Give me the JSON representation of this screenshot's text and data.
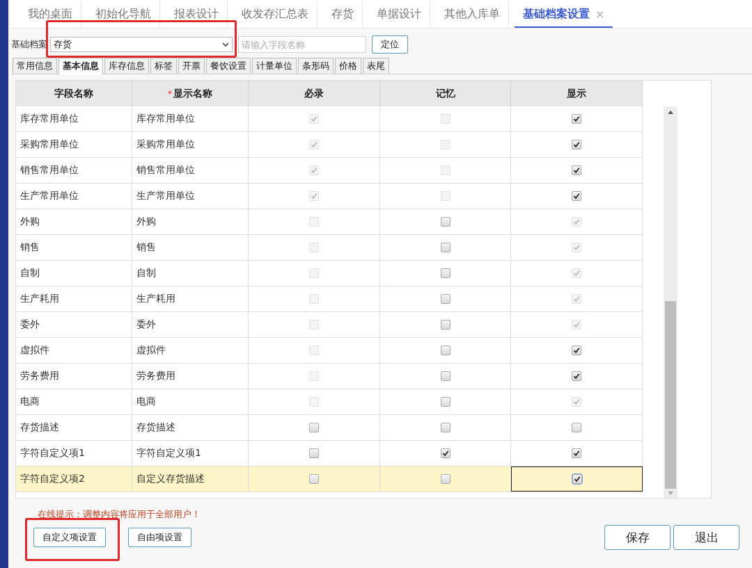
{
  "top_tabs": [
    {
      "label": "我的桌面",
      "selected": false
    },
    {
      "label": "初始化导航",
      "selected": false
    },
    {
      "label": "报表设计",
      "selected": false
    },
    {
      "label": "收发存汇总表",
      "selected": false
    },
    {
      "label": "存货",
      "selected": false
    },
    {
      "label": "单据设计",
      "selected": false
    },
    {
      "label": "其他入库单",
      "selected": false
    },
    {
      "label": "基础档案设置",
      "selected": true,
      "close": "×"
    }
  ],
  "archive": {
    "label": "基础档案",
    "value": "存货"
  },
  "search": {
    "placeholder": "请输入字段名称"
  },
  "locate_button": "定位",
  "sub_tabs": [
    {
      "label": "常用信息",
      "selected": false
    },
    {
      "label": "基本信息",
      "selected": true
    },
    {
      "label": "库存信息",
      "selected": false
    },
    {
      "label": "标签",
      "selected": false
    },
    {
      "label": "开票",
      "selected": false
    },
    {
      "label": "餐饮设置",
      "selected": false
    },
    {
      "label": "计量单位",
      "selected": false
    },
    {
      "label": "条形码",
      "selected": false
    },
    {
      "label": "价格",
      "selected": false
    },
    {
      "label": "表尾",
      "selected": false
    }
  ],
  "table": {
    "columns": [
      {
        "label": "字段名称"
      },
      {
        "label": "显示名称",
        "mark": "*"
      },
      {
        "label": "必录"
      },
      {
        "label": "记忆"
      },
      {
        "label": "显示"
      }
    ],
    "rows": [
      {
        "field": "库存常用单位",
        "display": "库存常用单位",
        "selected": false,
        "required": {
          "checked": true,
          "disabled": true
        },
        "memory": {
          "checked": false,
          "disabled": true
        },
        "show": {
          "checked": true,
          "disabled": false
        }
      },
      {
        "field": "采购常用单位",
        "display": "采购常用单位",
        "selected": false,
        "required": {
          "checked": true,
          "disabled": true
        },
        "memory": {
          "checked": false,
          "disabled": true
        },
        "show": {
          "checked": true,
          "disabled": false
        }
      },
      {
        "field": "销售常用单位",
        "display": "销售常用单位",
        "selected": false,
        "required": {
          "checked": true,
          "disabled": true
        },
        "memory": {
          "checked": false,
          "disabled": true
        },
        "show": {
          "checked": true,
          "disabled": false
        }
      },
      {
        "field": "生产常用单位",
        "display": "生产常用单位",
        "selected": false,
        "required": {
          "checked": true,
          "disabled": true
        },
        "memory": {
          "checked": false,
          "disabled": true
        },
        "show": {
          "checked": true,
          "disabled": false
        }
      },
      {
        "field": "外购",
        "display": "外购",
        "selected": false,
        "required": {
          "checked": false,
          "disabled": true
        },
        "memory": {
          "checked": false,
          "disabled": false
        },
        "show": {
          "checked": true,
          "disabled": true
        }
      },
      {
        "field": "销售",
        "display": "销售",
        "selected": false,
        "required": {
          "checked": false,
          "disabled": true
        },
        "memory": {
          "checked": false,
          "disabled": false
        },
        "show": {
          "checked": true,
          "disabled": true
        }
      },
      {
        "field": "自制",
        "display": "自制",
        "selected": false,
        "required": {
          "checked": false,
          "disabled": true
        },
        "memory": {
          "checked": false,
          "disabled": false
        },
        "show": {
          "checked": true,
          "disabled": true
        }
      },
      {
        "field": "生产耗用",
        "display": "生产耗用",
        "selected": false,
        "required": {
          "checked": false,
          "disabled": true
        },
        "memory": {
          "checked": false,
          "disabled": false
        },
        "show": {
          "checked": true,
          "disabled": true
        }
      },
      {
        "field": "委外",
        "display": "委外",
        "selected": false,
        "required": {
          "checked": false,
          "disabled": true
        },
        "memory": {
          "checked": false,
          "disabled": false
        },
        "show": {
          "checked": true,
          "disabled": true
        }
      },
      {
        "field": "虚拟件",
        "display": "虚拟件",
        "selected": false,
        "required": {
          "checked": false,
          "disabled": true
        },
        "memory": {
          "checked": false,
          "disabled": false
        },
        "show": {
          "checked": true,
          "disabled": false
        }
      },
      {
        "field": "劳务费用",
        "display": "劳务费用",
        "selected": false,
        "required": {
          "checked": false,
          "disabled": true
        },
        "memory": {
          "checked": false,
          "disabled": false
        },
        "show": {
          "checked": true,
          "disabled": false
        }
      },
      {
        "field": "电商",
        "display": "电商",
        "selected": false,
        "required": {
          "checked": false,
          "disabled": true
        },
        "memory": {
          "checked": false,
          "disabled": false
        },
        "show": {
          "checked": true,
          "disabled": true
        }
      },
      {
        "field": "存货描述",
        "display": "存货描述",
        "selected": false,
        "required": {
          "checked": false,
          "disabled": false
        },
        "memory": {
          "checked": false,
          "disabled": false
        },
        "show": {
          "checked": false,
          "disabled": false
        }
      },
      {
        "field": "字符自定义项1",
        "display": "字符自定义项1",
        "selected": false,
        "required": {
          "checked": false,
          "disabled": false
        },
        "memory": {
          "checked": true,
          "disabled": false
        },
        "show": {
          "checked": true,
          "disabled": false
        }
      },
      {
        "field": "字符自定义项2",
        "display": "自定义存货描述",
        "selected": true,
        "required": {
          "checked": false,
          "disabled": false
        },
        "memory": {
          "checked": false,
          "disabled": false
        },
        "show": {
          "checked": true,
          "disabled": false
        }
      }
    ]
  },
  "hint": "在线提示：调整内容将应用于全部用户！",
  "left_buttons": [
    "自定义项设置",
    "自由项设置"
  ],
  "right_buttons": [
    "保存",
    "退出"
  ]
}
